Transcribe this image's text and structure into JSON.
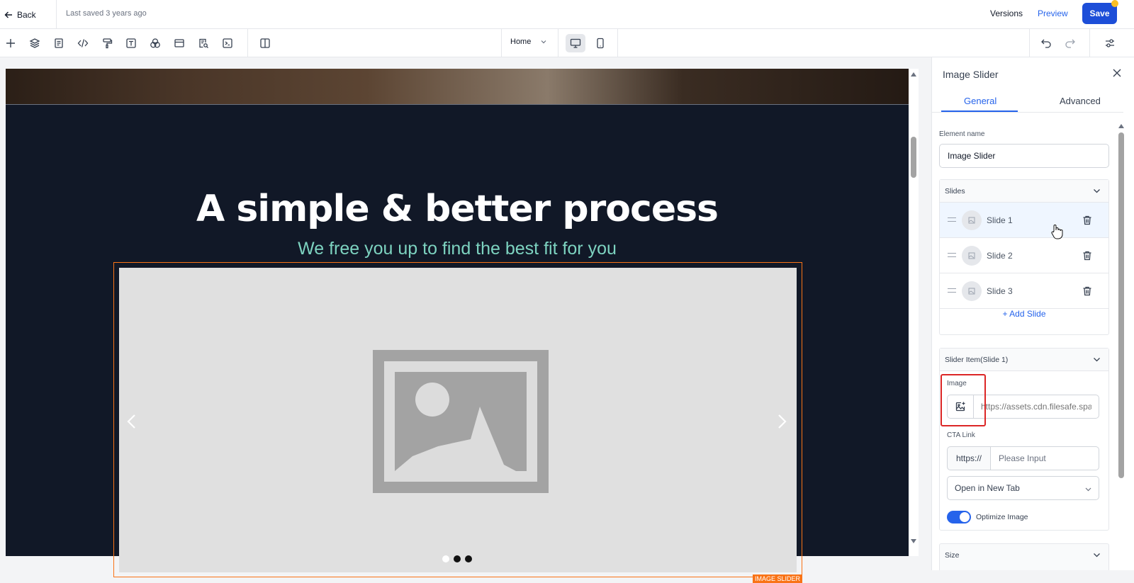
{
  "topbar": {
    "back_label": "Back",
    "last_saved": "Last saved 3 years ago",
    "versions_label": "Versions",
    "preview_label": "Preview",
    "save_label": "Save"
  },
  "toolbar": {
    "tools": [
      "plus-icon",
      "layers-icon",
      "page-icon",
      "code-icon",
      "paint-roller-icon",
      "text-icon",
      "color-circles-icon",
      "section-icon",
      "search-doc-icon",
      "terminal-icon",
      "split-view-icon"
    ],
    "page_select": "Home",
    "devices": [
      "desktop-icon",
      "mobile-icon"
    ],
    "active_device": "desktop",
    "undo_icon": "undo-icon",
    "redo_icon": "redo-icon",
    "settings_icon": "sliders-icon"
  },
  "canvas": {
    "title": "A simple & better process",
    "subtitle": "We free you up to find the best fit for you",
    "slider_tag": "IMAGE SLIDER",
    "dots_count": 3,
    "active_dot": 0,
    "colors": {
      "section_bg": "#111827",
      "subtitle": "#7dd3c0",
      "slider_outline": "#f97316"
    }
  },
  "panel": {
    "title": "Image Slider",
    "tabs": [
      {
        "label": "General",
        "active": true
      },
      {
        "label": "Advanced",
        "active": false
      }
    ],
    "element_name_label": "Element name",
    "element_name_value": "Image Slider",
    "slides_header": "Slides",
    "slides": [
      {
        "label": "Slide 1",
        "selected": true
      },
      {
        "label": "Slide 2",
        "selected": false
      },
      {
        "label": "Slide 3",
        "selected": false
      }
    ],
    "add_slide_label": "+ Add Slide",
    "slider_item_header": "Slider Item(Slide 1)",
    "image_label": "Image",
    "image_url_placeholder": "https://assets.cdn.filesafe.space",
    "cta_label": "CTA Link",
    "cta_prefix": "https://",
    "cta_placeholder": "Please Input",
    "open_option": "Open in New Tab",
    "optimize_label": "Optimize Image",
    "optimize_on": true,
    "size_header": "Size"
  }
}
